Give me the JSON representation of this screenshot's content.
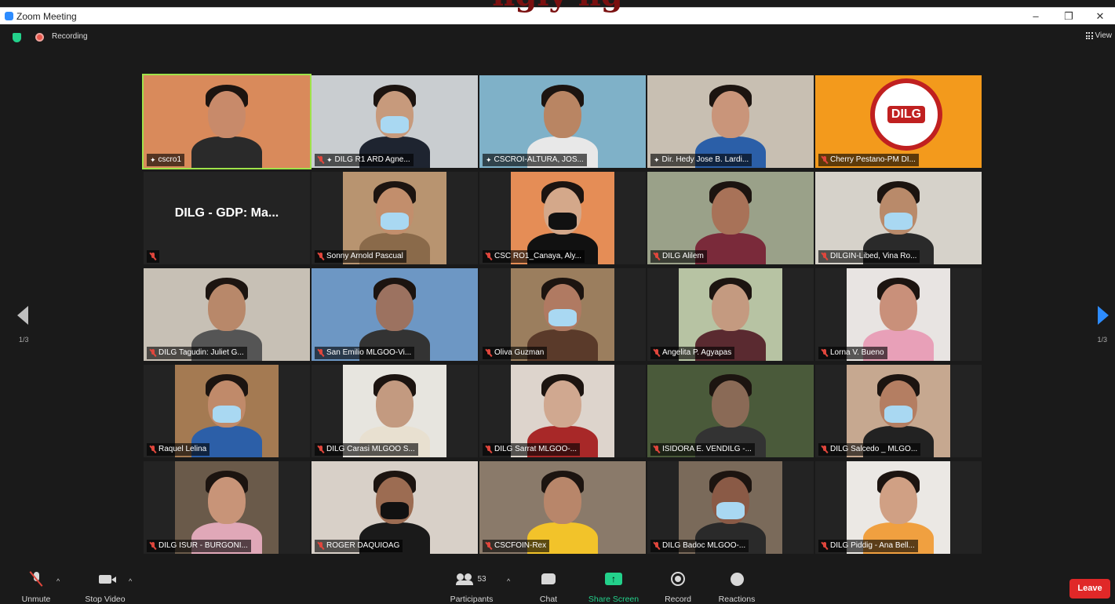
{
  "window": {
    "title": "Zoom Meeting",
    "overlay_banner": "ngly    ng",
    "minimize": "–",
    "restore": "❐",
    "close": "✕"
  },
  "status": {
    "recording_label": "Recording",
    "view_label": "View"
  },
  "pagination": {
    "left_page": "1/3",
    "right_page": "1/3"
  },
  "participants": [
    {
      "name": "cscro1",
      "pinned": true,
      "muted": false,
      "bg": "#d98a5b",
      "skin": "#c88a6a",
      "shirt": "#2a2a2a",
      "active": true
    },
    {
      "name": "DILG R1 ARD Agne...",
      "pinned": true,
      "muted": true,
      "bg": "#c9cdd0",
      "skin": "#c79a7c",
      "shirt": "#1e2430",
      "mask": true
    },
    {
      "name": "CSCROI-ALTURA, JOS...",
      "pinned": true,
      "muted": false,
      "bg": "#7fb1c8",
      "skin": "#b98563",
      "shirt": "#e8e8e8"
    },
    {
      "name": "Dir. Hedy Jose B. Lardi...",
      "pinned": true,
      "muted": false,
      "bg": "#c8bfb2",
      "skin": "#c9957a",
      "shirt": "#2b5fa8"
    },
    {
      "name": "Cherry Pestano-PM DI...",
      "pinned": false,
      "muted": true,
      "bg": "#f39a1c",
      "logo": "DILG"
    },
    {
      "name": "",
      "pinned": false,
      "muted": true,
      "bg": "#232323",
      "placeholder": "DILG - GDP: Ma..."
    },
    {
      "name": "Sonny Arnold Pascual",
      "pinned": false,
      "muted": true,
      "bg": "#b89470",
      "skin": "#c28e6c",
      "shirt": "#8a6a4a",
      "mask": true,
      "narrow": true
    },
    {
      "name": "CSC RO1_Canaya, Aly...",
      "pinned": false,
      "muted": true,
      "bg": "#e58d56",
      "skin": "#d4a88a",
      "shirt": "#111111",
      "mask_dark": true,
      "narrow": true
    },
    {
      "name": "DILG Alilem",
      "pinned": false,
      "muted": true,
      "bg": "#9aa189",
      "skin": "#a87258",
      "shirt": "#7a2a3a"
    },
    {
      "name": "DILGIN-Libed, Vina Ro...",
      "pinned": false,
      "muted": true,
      "bg": "#d6d2ca",
      "skin": "#b98a6a",
      "shirt": "#2a2a2a",
      "mask": true
    },
    {
      "name": "DILG Tagudin: Juliet G...",
      "pinned": false,
      "muted": true,
      "bg": "#c7c0b5",
      "skin": "#b8886a",
      "shirt": "#555555"
    },
    {
      "name": "San Emilio MLGOO-Vi...",
      "pinned": false,
      "muted": true,
      "bg": "#6d97c4",
      "skin": "#9c7260",
      "shirt": "#333333"
    },
    {
      "name": "Oliva Guzman",
      "pinned": false,
      "muted": true,
      "bg": "#9b7e5e",
      "skin": "#b07a62",
      "shirt": "#5a3a2a",
      "mask": true,
      "narrow": true
    },
    {
      "name": "Angelita P. Agyapas",
      "pinned": false,
      "muted": true,
      "bg": "#b7c3a3",
      "skin": "#c49a80",
      "shirt": "#5a2a30",
      "narrow": true
    },
    {
      "name": "Lorna V. Bueno",
      "pinned": false,
      "muted": true,
      "bg": "#e8e4e2",
      "skin": "#c9907a",
      "shirt": "#e8a0b8",
      "narrow": true
    },
    {
      "name": "Raquel Lelina",
      "pinned": false,
      "muted": true,
      "bg": "#a47a52",
      "skin": "#c08a6a",
      "shirt": "#2c5fa8",
      "mask": true,
      "narrow": true
    },
    {
      "name": "DILG Carasi MLGOO S...",
      "pinned": false,
      "muted": true,
      "bg": "#e7e5df",
      "skin": "#c39a80",
      "shirt": "#e8e0d0",
      "narrow": true
    },
    {
      "name": "DILG Sarrat MLGOO-...",
      "pinned": false,
      "muted": true,
      "bg": "#ddd4cc",
      "skin": "#d0a890",
      "shirt": "#a82828",
      "narrow": true
    },
    {
      "name": "ISIDORA E. VENDILG -...",
      "pinned": false,
      "muted": true,
      "bg": "#4a5a3a",
      "skin": "#8a6a56",
      "shirt": "#333333"
    },
    {
      "name": "DILG Salcedo _ MLGO...",
      "pinned": false,
      "muted": true,
      "bg": "#c6a890",
      "skin": "#b47e62",
      "shirt": "#222222",
      "mask": true,
      "narrow": true
    },
    {
      "name": "DILG ISUR - BURGONI...",
      "pinned": false,
      "muted": true,
      "bg": "#6a5a4a",
      "skin": "#c89478",
      "shirt": "#e0a8b8",
      "narrow": true
    },
    {
      "name": "ROGER DAQUIOAG",
      "pinned": false,
      "muted": true,
      "bg": "#d8d0c8",
      "skin": "#9c6c52",
      "shirt": "#1a1a1a",
      "mask_dark": true
    },
    {
      "name": "CSCFOIN-Rex",
      "pinned": false,
      "muted": true,
      "bg": "#8a7a6a",
      "skin": "#b8866a",
      "shirt": "#f2c32a"
    },
    {
      "name": "DILG Badoc MLGOO-...",
      "pinned": false,
      "muted": true,
      "bg": "#7a6a5a",
      "skin": "#8a5a46",
      "shirt": "#2a2a2a",
      "mask": true,
      "narrow": true
    },
    {
      "name": "DILG Piddig - Ana Bell...",
      "pinned": false,
      "muted": true,
      "bg": "#ebe8e4",
      "skin": "#d0a084",
      "shirt": "#f0a040",
      "narrow": true
    }
  ],
  "toolbar": {
    "unmute": "Unmute",
    "stop_video": "Stop Video",
    "participants": "Participants",
    "participants_count": "53",
    "chat": "Chat",
    "share_screen": "Share Screen",
    "record": "Record",
    "reactions": "Reactions",
    "leave": "Leave"
  },
  "colors": {
    "active_speaker": "#9fe34a",
    "share_green": "#23d18b",
    "leave_red": "#e02828",
    "zoom_blue": "#2d8cff"
  }
}
